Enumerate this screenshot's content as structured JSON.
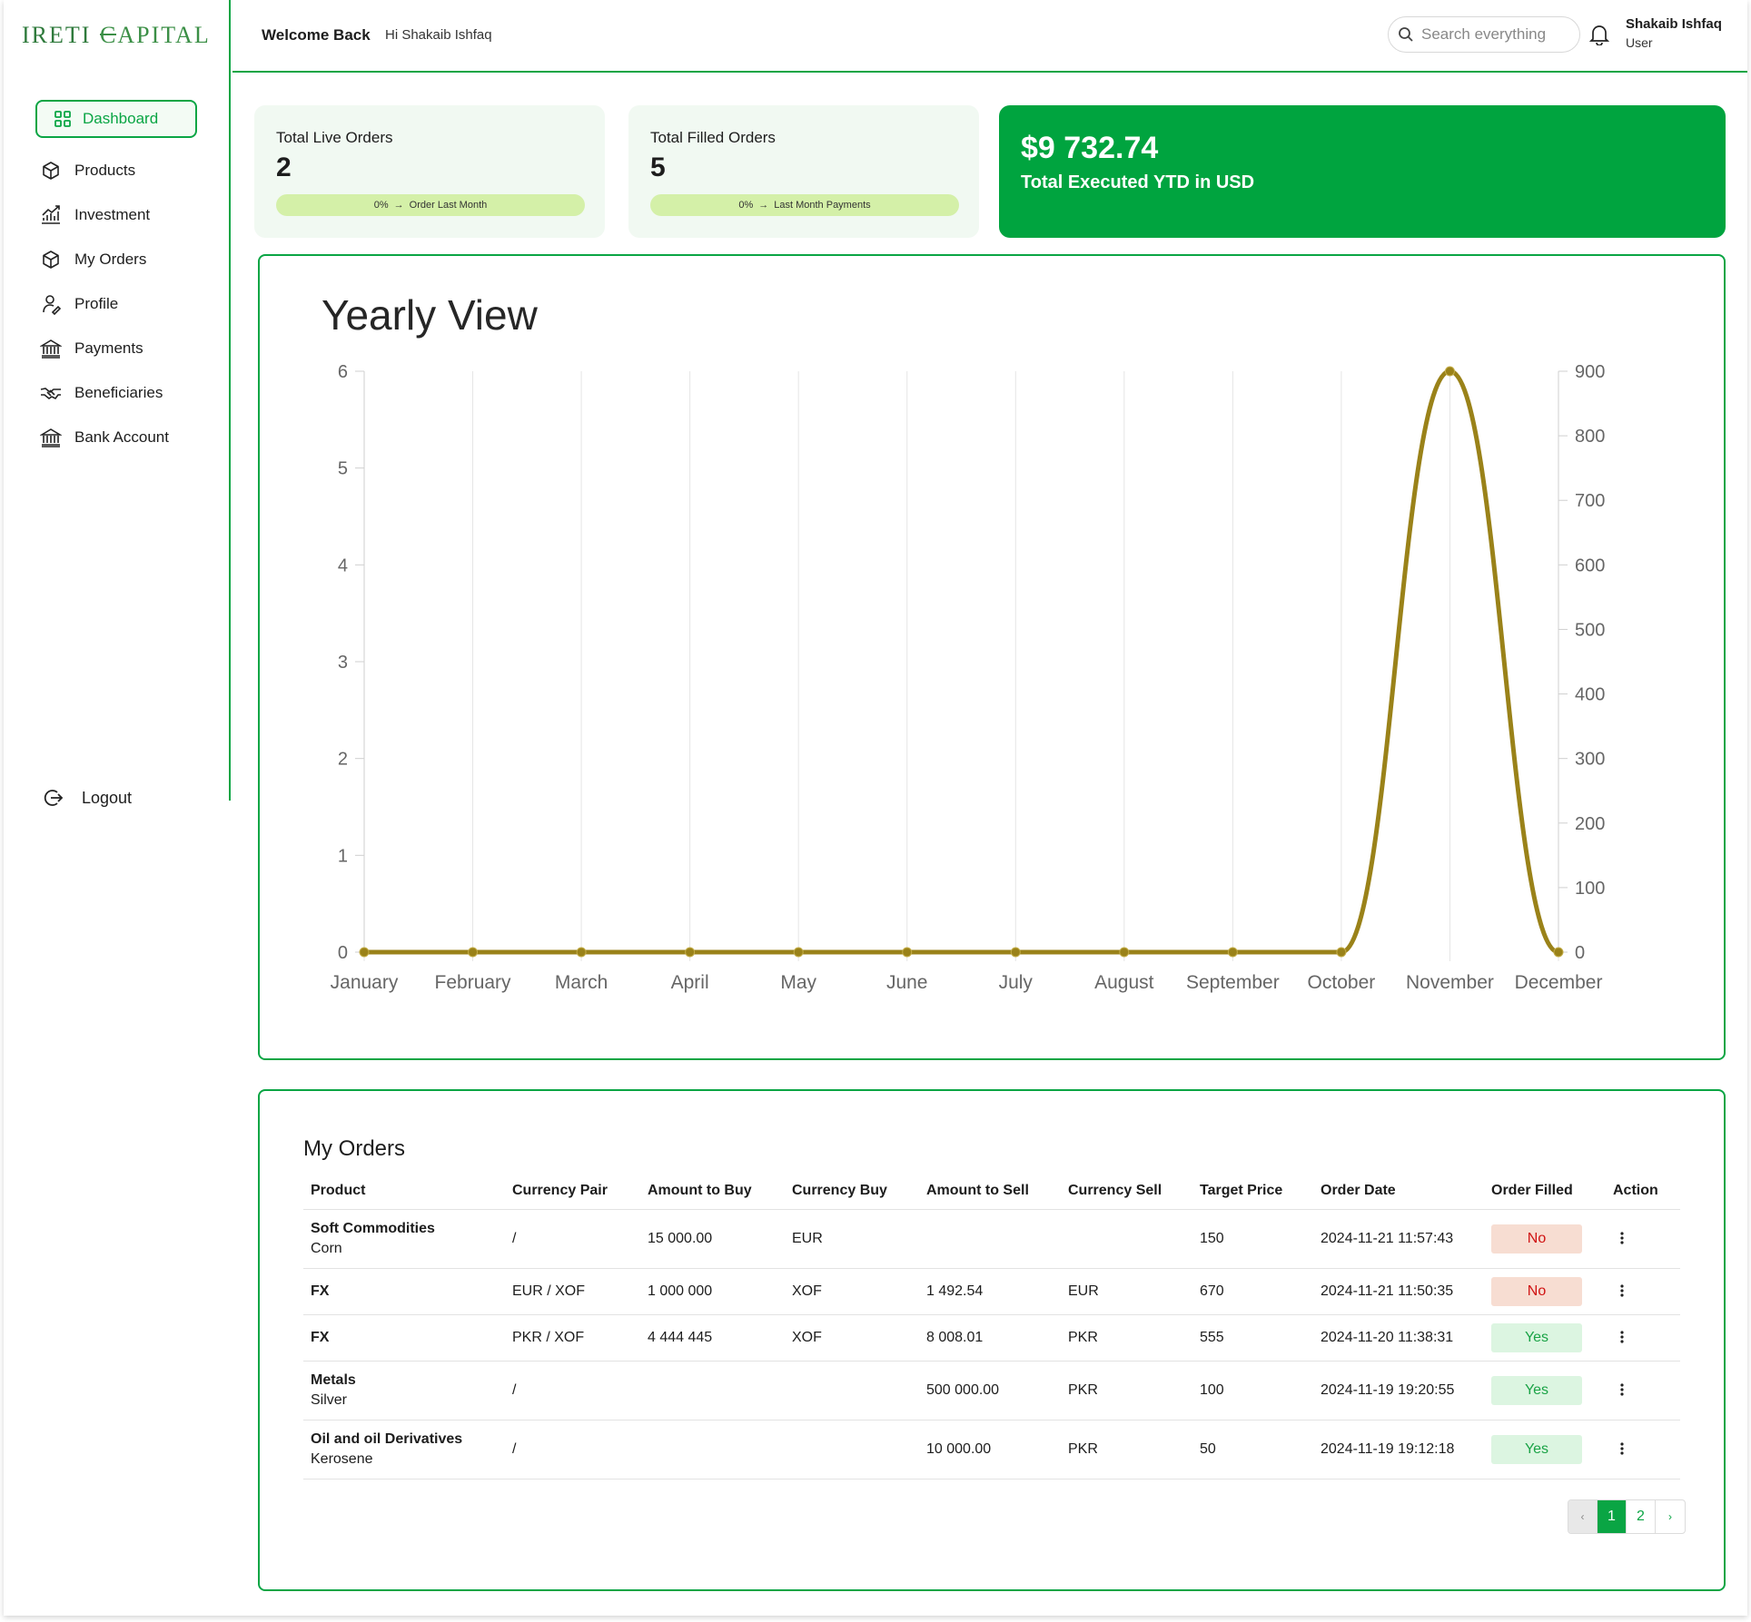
{
  "brand": {
    "logo_text": "IRETI CAPITAL"
  },
  "header": {
    "welcome": "Welcome Back",
    "greeting": "Hi Shakaib Ishfaq",
    "search_placeholder": "Search everything",
    "user_name": "Shakaib Ishfaq",
    "user_role": "User"
  },
  "sidebar": {
    "active": "Dashboard",
    "items": [
      {
        "label": "Products",
        "icon": "cube-icon"
      },
      {
        "label": "Investment",
        "icon": "chart-growth-icon"
      },
      {
        "label": "My Orders",
        "icon": "cube-icon"
      },
      {
        "label": "Profile",
        "icon": "user-icon"
      },
      {
        "label": "Payments",
        "icon": "bank-icon"
      },
      {
        "label": "Beneficiaries",
        "icon": "handshake-icon"
      },
      {
        "label": "Bank Account",
        "icon": "bank-icon"
      }
    ],
    "logout": "Logout"
  },
  "stats": {
    "live": {
      "label": "Total Live Orders",
      "value": "2",
      "pct": "0%",
      "note": "Order Last Month"
    },
    "filled": {
      "label": "Total Filled Orders",
      "value": "5",
      "pct": "0%",
      "note": "Last Month Payments"
    },
    "executed": {
      "amount": "$9 732.74",
      "label": "Total Executed YTD in USD"
    }
  },
  "chart_data": {
    "type": "line",
    "title": "Yearly View",
    "categories": [
      "January",
      "February",
      "March",
      "April",
      "May",
      "June",
      "July",
      "August",
      "September",
      "October",
      "November",
      "December"
    ],
    "series": [
      {
        "values": [
          0,
          0,
          0,
          0,
          0,
          0,
          0,
          0,
          0,
          0,
          900,
          0
        ],
        "axis": "right",
        "color": "#9a8219"
      }
    ],
    "y_left": {
      "ylim": [
        0,
        6
      ],
      "ticks": [
        0,
        1,
        2,
        3,
        4,
        5,
        6
      ]
    },
    "y_right": {
      "ylim": [
        0,
        900
      ],
      "ticks": [
        0,
        100,
        200,
        300,
        400,
        500,
        600,
        700,
        800,
        900
      ]
    },
    "grid": "vertical"
  },
  "orders": {
    "title": "My Orders",
    "columns": [
      "Product",
      "Currency Pair",
      "Amount to Buy",
      "Currency Buy",
      "Amount to Sell",
      "Currency Sell",
      "Target Price",
      "Order Date",
      "Order Filled",
      "Action"
    ],
    "rows": [
      {
        "product": "Soft Commodities",
        "sub": "Corn",
        "pair": "/",
        "buy_amt": "15 000.00",
        "buy_ccy": "EUR",
        "sell_amt": "",
        "sell_ccy": "",
        "target": "150",
        "date": "2024-11-21 11:57:43",
        "filled": "No"
      },
      {
        "product": "FX",
        "sub": "",
        "pair": "EUR / XOF",
        "buy_amt": "1 000 000",
        "buy_ccy": "XOF",
        "sell_amt": "1 492.54",
        "sell_ccy": "EUR",
        "target": "670",
        "date": "2024-11-21 11:50:35",
        "filled": "No"
      },
      {
        "product": "FX",
        "sub": "",
        "pair": "PKR / XOF",
        "buy_amt": "4 444 445",
        "buy_ccy": "XOF",
        "sell_amt": "8 008.01",
        "sell_ccy": "PKR",
        "target": "555",
        "date": "2024-11-20 11:38:31",
        "filled": "Yes"
      },
      {
        "product": "Metals",
        "sub": "Silver",
        "pair": "/",
        "buy_amt": "",
        "buy_ccy": "",
        "sell_amt": "500 000.00",
        "sell_ccy": "PKR",
        "target": "100",
        "date": "2024-11-19 19:20:55",
        "filled": "Yes"
      },
      {
        "product": "Oil and oil Derivatives",
        "sub": "Kerosene",
        "pair": "/",
        "buy_amt": "",
        "buy_ccy": "",
        "sell_amt": "10 000.00",
        "sell_ccy": "PKR",
        "target": "50",
        "date": "2024-11-19 19:12:18",
        "filled": "Yes"
      }
    ],
    "pagination": {
      "prev": "‹",
      "pages": [
        "1",
        "2"
      ],
      "current": "1",
      "next": "›"
    }
  },
  "colors": {
    "accent": "#0aa544",
    "green_card": "#00a43f",
    "line": "#9a8219",
    "pill": "#d4f0a8"
  }
}
